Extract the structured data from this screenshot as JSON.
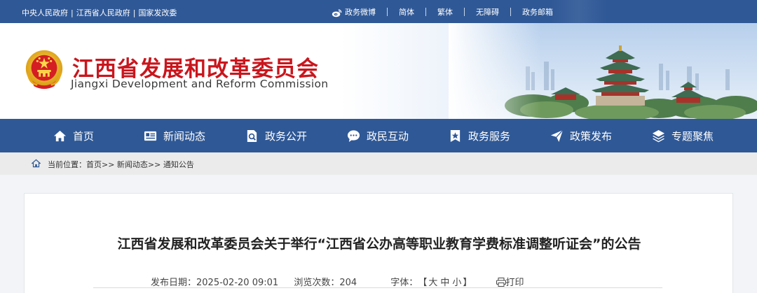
{
  "topbar": {
    "links": [
      "中央人民政府",
      "江西省人民政府",
      "国家发改委"
    ],
    "separator": "|",
    "weibo_label": "政务微博",
    "items": [
      "简体",
      "繁体",
      "无障碍",
      "政务邮箱"
    ],
    "icons": {
      "weibo": "weibo-icon"
    }
  },
  "header": {
    "title": "江西省发展和改革委员会",
    "subtitle": "Jiangxi Development and Reform Commission",
    "emblem": "national-emblem",
    "colors": {
      "title": "#c9161d",
      "accent": "#2f5896"
    }
  },
  "nav": {
    "items": [
      {
        "label": "首页",
        "icon": "home-icon"
      },
      {
        "label": "新闻动态",
        "icon": "news-icon"
      },
      {
        "label": "政务公开",
        "icon": "document-search-icon"
      },
      {
        "label": "政民互动",
        "icon": "chat-icon"
      },
      {
        "label": "政务服务",
        "icon": "star-bookmark-icon"
      },
      {
        "label": "政策发布",
        "icon": "send-icon"
      },
      {
        "label": "专题聚焦",
        "icon": "layers-icon"
      }
    ]
  },
  "breadcrumb": {
    "prefix": "当前位置：",
    "path": "首页>> 新闻动态>> 通知公告",
    "icon": "home-outline-icon"
  },
  "article": {
    "title": "江西省发展和改革委员会关于举行“江西省公办高等职业教育学费标准调整听证会”的公告",
    "date_label": "发布日期：",
    "date_value": "2025-02-20 09:01",
    "views_label": "浏览次数：",
    "views_value": "204",
    "font_label": "字体：",
    "font_open": "【",
    "font_large": "大",
    "font_medium": "中",
    "font_small": "小",
    "font_close": "】",
    "print_label": "打印",
    "print_icon": "printer-icon"
  }
}
